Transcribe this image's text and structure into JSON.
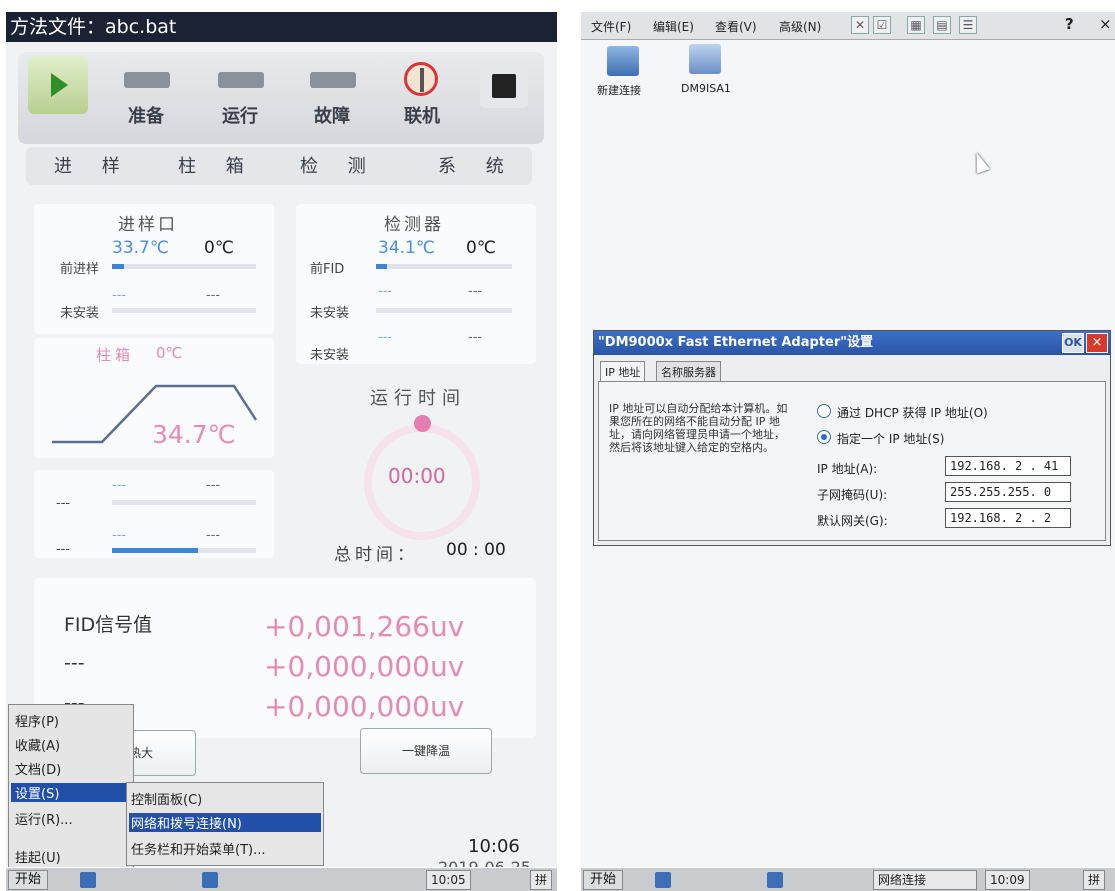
{
  "left": {
    "title": "方法文件：abc.bat",
    "indicators": [
      "准备",
      "运行",
      "故障",
      "联机"
    ],
    "tabs": [
      "进 样",
      "柱 箱",
      "检 测",
      "系 统"
    ],
    "inlet": {
      "title": "进样口",
      "front_label": "前进样",
      "front_actual": "33.7℃",
      "front_set": "0℃",
      "front_progress": 0.08,
      "rear_label": "未安装",
      "rear_actual": "---",
      "rear_set": "---"
    },
    "detector": {
      "title": "检测器",
      "front_label": "前FID",
      "front_actual": "34.1℃",
      "front_set": "0℃",
      "front_progress": 0.08,
      "row2_label": "未安装",
      "row3_label": "未安装",
      "dash": "---"
    },
    "oven": {
      "title": "柱箱",
      "set": "0℃",
      "actual": "34.7℃"
    },
    "aux": {
      "row1_label": "---",
      "row2_label": "---",
      "dash": "---",
      "progress": 0.6
    },
    "run_time": {
      "title": "运行时间",
      "value": "00:00",
      "total_label": "总时间：",
      "total_value": "00 : 00"
    },
    "signals": [
      {
        "label": "FID信号值",
        "value": "+0,001,266uv"
      },
      {
        "label": "---",
        "value": "+0,000,000uv"
      },
      {
        "label": "---",
        "value": "+0,000,000uv"
      }
    ],
    "buttons": {
      "left_partial": "热大",
      "cool_down": "一键降温"
    },
    "start_menu": {
      "items": [
        "程序(P)",
        "收藏(A)",
        "文档(D)",
        "设置(S)",
        "运行(R)...",
        "挂起(U)"
      ],
      "submenu": [
        "控制面板(C)",
        "网络和拨号连接(N)",
        "任务栏和开始菜单(T)..."
      ]
    },
    "clock_big": "10:06",
    "date_partial": "2019-06-25",
    "taskbar": {
      "start": "开始",
      "time": "10:05",
      "ime": "拼"
    }
  },
  "right": {
    "menu": [
      "文件(F)",
      "编辑(E)",
      "查看(V)",
      "高级(N)"
    ],
    "help": "?",
    "close": "×",
    "icons": [
      {
        "label": "新建连接"
      },
      {
        "label": "DM9ISA1"
      }
    ],
    "dialog": {
      "title": "\"DM9000x Fast Ethernet Adapter\"设置",
      "ok": "OK",
      "close": "×",
      "tabs": [
        "IP 地址",
        "名称服务器"
      ],
      "description": "IP 地址可以自动分配给本计算机。如果您所在的网络不能自动分配 IP 地址，请向网络管理员申请一个地址，然后将该地址键入给定的空格内。",
      "dhcp_label": "通过 DHCP 获得 IP 地址(O)",
      "static_label": "指定一个 IP 地址(S)",
      "selected": "static",
      "fields": [
        {
          "label": "IP 地址(A):",
          "value": "192.168. 2 . 41"
        },
        {
          "label": "子网掩码(U):",
          "value": "255.255.255. 0"
        },
        {
          "label": "默认网关(G):",
          "value": "192.168. 2 . 2"
        }
      ]
    },
    "taskbar": {
      "start": "开始",
      "task": "网络连接",
      "time": "10:09",
      "ime": "拼"
    }
  }
}
